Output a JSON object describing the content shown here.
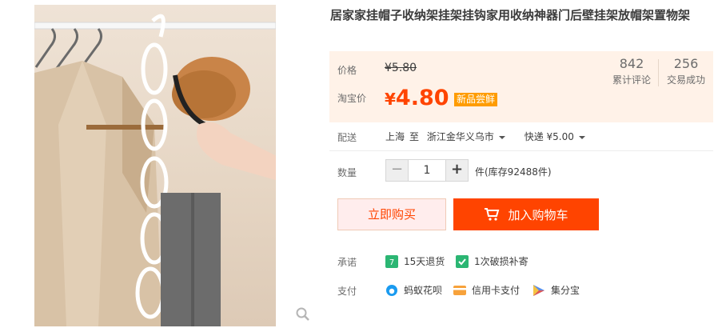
{
  "product": {
    "title": "居家家挂帽子收纳架挂架挂钩家用收纳神器门后壁挂架放帽架置物架"
  },
  "price_panel": {
    "price_label": "价格",
    "original_price": "¥5.80",
    "taobao_price_label": "淘宝价",
    "currency": "¥",
    "promo_price": "4.80",
    "promo_badge": "新品尝鲜",
    "reviews_count": "842",
    "reviews_label": "累计评论",
    "sales_count": "256",
    "sales_label": "交易成功"
  },
  "delivery": {
    "label": "配送",
    "from": "上海",
    "to_word": "至",
    "destination": "浙江金华义乌市",
    "method": "快递 ¥5.00"
  },
  "quantity": {
    "label": "数量",
    "minus": "−",
    "value": "1",
    "plus": "+",
    "stock_text": "件(库存92488件)"
  },
  "actions": {
    "buy_now": "立即购买",
    "add_to_cart": "加入购物车"
  },
  "promises": {
    "label": "承诺",
    "items": [
      {
        "text": "15天退货",
        "icon": "return-7day-icon",
        "color": "#2bb673"
      },
      {
        "text": "1次破损补寄",
        "icon": "shield-check-icon",
        "color": "#2bb673"
      }
    ]
  },
  "payment": {
    "label": "支付",
    "items": [
      {
        "text": "蚂蚁花呗",
        "icon": "huabei-icon",
        "color": "#1a9bf0"
      },
      {
        "text": "信用卡支付",
        "icon": "credit-card-icon",
        "color": "#f7a23b"
      },
      {
        "text": "集分宝",
        "icon": "jifenbao-icon",
        "color": "#5a8de8"
      }
    ]
  },
  "colors": {
    "accent": "#ff4400",
    "panel_bg": "#fff2e8",
    "badge": "#ff9c00"
  }
}
